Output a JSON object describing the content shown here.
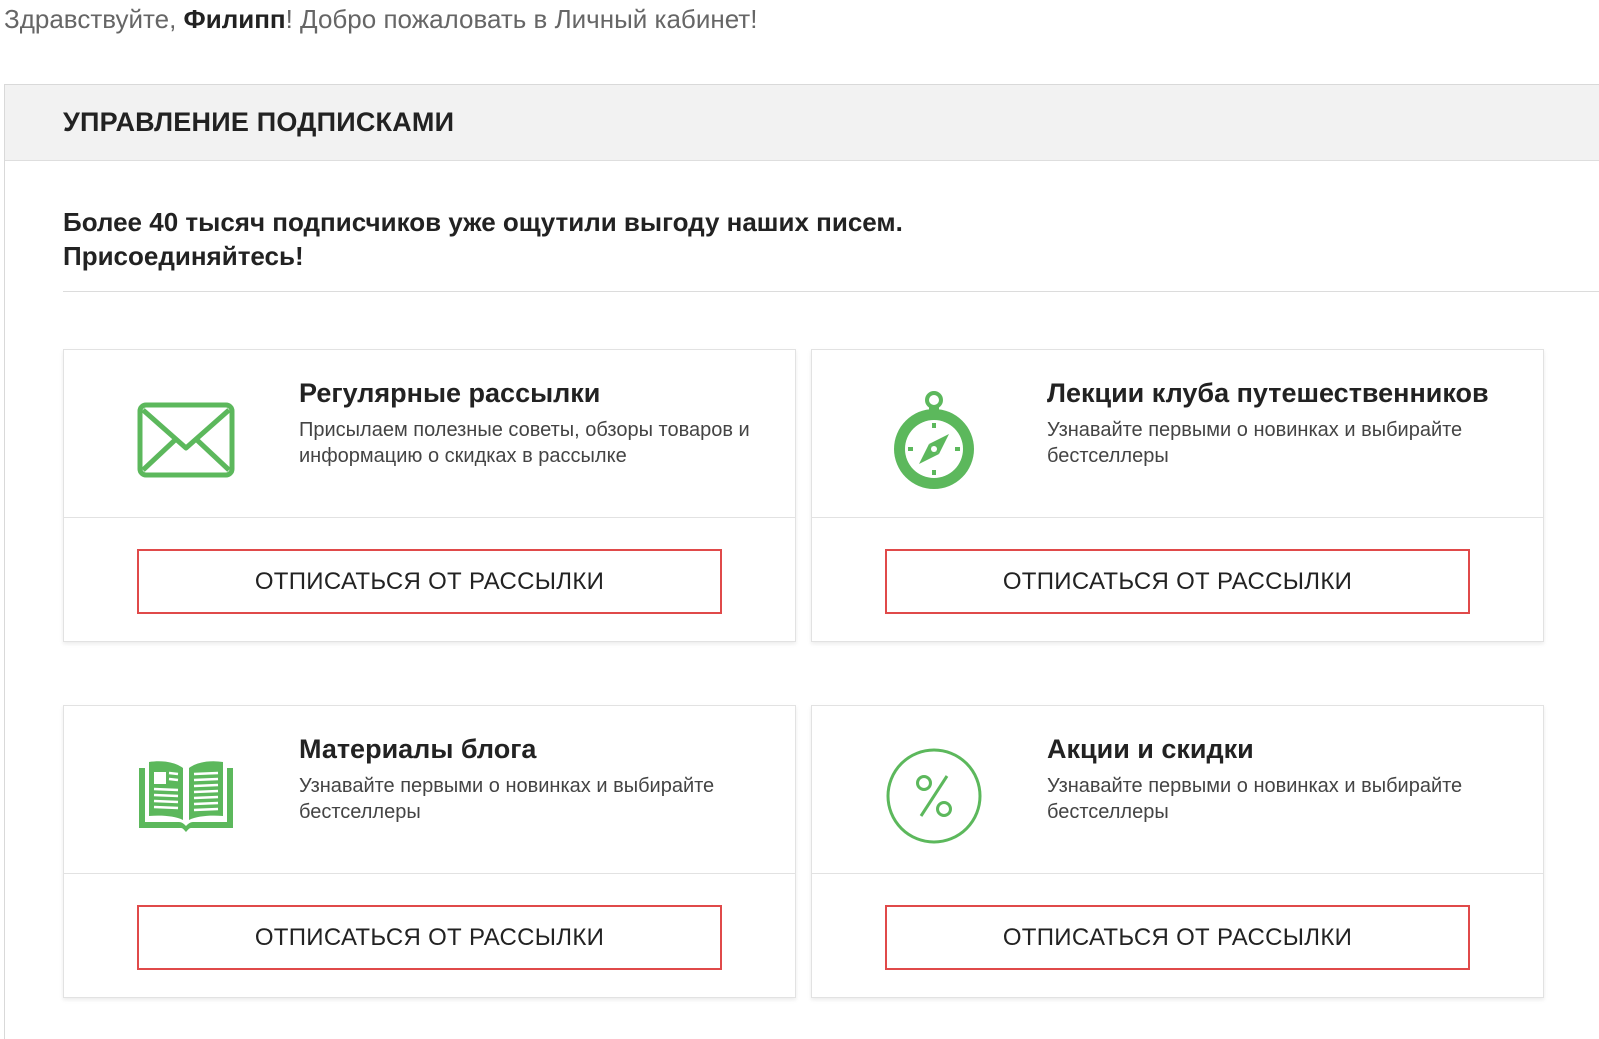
{
  "greeting": {
    "prefix": "Здравствуйте, ",
    "name": "Филипп",
    "suffix": "! Добро пожаловать в Личный кабинет!"
  },
  "panel": {
    "title": "УПРАВЛЕНИЕ ПОДПИСКАМИ",
    "intro_line1": "Более 40 тысяч подписчиков уже ощутили выгоду наших писем.",
    "intro_line2": "Присоединяйтесь!"
  },
  "accent_color": "#5cb85c",
  "button_border_color": "#e04a4a",
  "subscriptions": [
    {
      "icon": "envelope-icon",
      "title": "Регулярные рассылки",
      "description": "Присылаем полезные советы, обзоры товаров и информацию о скидках в рассылке",
      "button_label": "ОТПИСАТЬСЯ ОТ РАССЫЛКИ"
    },
    {
      "icon": "compass-icon",
      "title": "Лекции клуба путешественников",
      "description": "Узнавайте первыми о новинках и выбирайте бестселлеры",
      "button_label": "ОТПИСАТЬСЯ ОТ РАССЫЛКИ"
    },
    {
      "icon": "book-icon",
      "title": "Материалы блога",
      "description": "Узнавайте первыми о новинках и выбирайте бестселлеры",
      "button_label": "ОТПИСАТЬСЯ ОТ РАССЫЛКИ"
    },
    {
      "icon": "percent-icon",
      "title": "Акции и скидки",
      "description": "Узнавайте первыми о новинках и выбирайте бестселлеры",
      "button_label": "ОТПИСАТЬСЯ ОТ РАССЫЛКИ"
    }
  ]
}
